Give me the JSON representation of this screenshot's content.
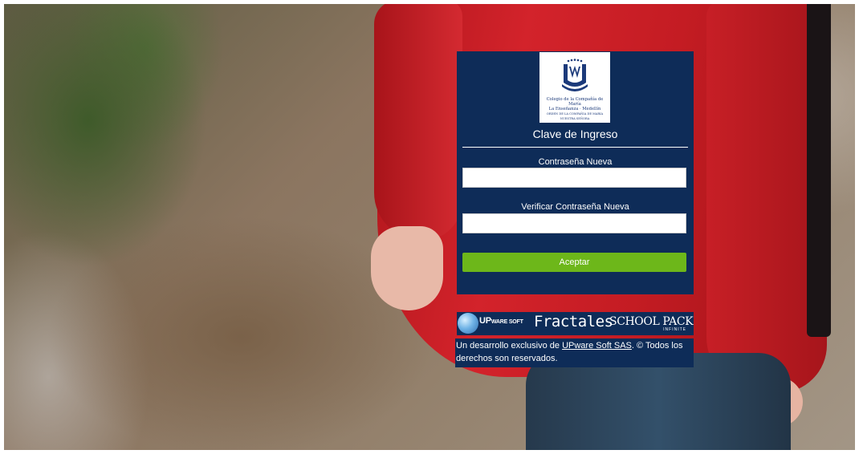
{
  "background": {
    "description_colors": {
      "jacket": "#c41c23",
      "foliage": "#3c5a28",
      "ground": "#8b7560"
    }
  },
  "logo": {
    "line1": "Colegio de la Compañía de María",
    "line2": "La Enseñanza · Medellín",
    "line3": "ORDEN DE LA COMPAÑIA DE MARIA NUESTRA SEÑORA",
    "icon": "school-crest-icon"
  },
  "form": {
    "title": "Clave de Ingreso",
    "new_password_label": "Contraseña Nueva",
    "new_password_value": "",
    "verify_password_label": "Verificar Contraseña Nueva",
    "verify_password_value": "",
    "submit_label": "Aceptar"
  },
  "brand": {
    "upware": "UP",
    "upware_small": "WARE SOFT",
    "fractales": "Fractales",
    "schoolpack": "SCHOOL PACK",
    "infinite": "INFINITE",
    "globe_icon": "globe-icon"
  },
  "footer": {
    "prefix": "Un desarrollo exclusivo de ",
    "link": "UPware Soft SAS",
    "suffix": ". © Todos los derechos son reservados."
  },
  "colors": {
    "panel": "#0e2c58",
    "accent": "#6db71a",
    "text": "#ffffff"
  }
}
